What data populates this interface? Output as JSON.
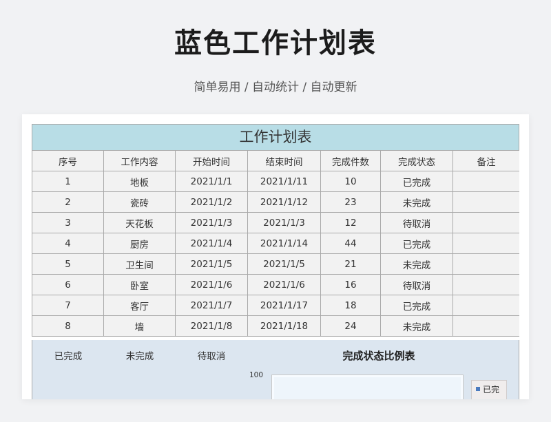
{
  "header": {
    "title": "蓝色工作计划表",
    "subtitle": "简单易用 / 自动统计 / 自动更新"
  },
  "sheet": {
    "title": "工作计划表",
    "columns": [
      "序号",
      "工作内容",
      "开始时间",
      "结束时间",
      "完成件数",
      "完成状态",
      "备注"
    ],
    "rows": [
      [
        "1",
        "地板",
        "2021/1/1",
        "2021/1/11",
        "10",
        "已完成",
        ""
      ],
      [
        "2",
        "瓷砖",
        "2021/1/2",
        "2021/1/12",
        "23",
        "未完成",
        ""
      ],
      [
        "3",
        "天花板",
        "2021/1/3",
        "2021/1/3",
        "12",
        "待取消",
        ""
      ],
      [
        "4",
        "厨房",
        "2021/1/4",
        "2021/1/14",
        "44",
        "已完成",
        ""
      ],
      [
        "5",
        "卫生间",
        "2021/1/5",
        "2021/1/5",
        "21",
        "未完成",
        ""
      ],
      [
        "6",
        "卧室",
        "2021/1/6",
        "2021/1/6",
        "16",
        "待取消",
        ""
      ],
      [
        "7",
        "客厅",
        "2021/1/7",
        "2021/1/17",
        "18",
        "已完成",
        ""
      ],
      [
        "8",
        "墙",
        "2021/1/8",
        "2021/1/18",
        "24",
        "未完成",
        ""
      ]
    ]
  },
  "summary": {
    "labels": [
      "已完成",
      "未完成",
      "待取消"
    ]
  },
  "chart_data": {
    "type": "bar",
    "title": "完成状态比例表",
    "y_ticks_visible": [
      "100"
    ],
    "legend": [
      "已完"
    ],
    "legend_position": "right",
    "colors": {
      "series": "#4a7bbf"
    }
  },
  "colors": {
    "title_bar": "#b8dde6",
    "cell_bg": "#f2f2f2",
    "panel_bg": "#dce6f0",
    "border": "#a9a9a9"
  }
}
